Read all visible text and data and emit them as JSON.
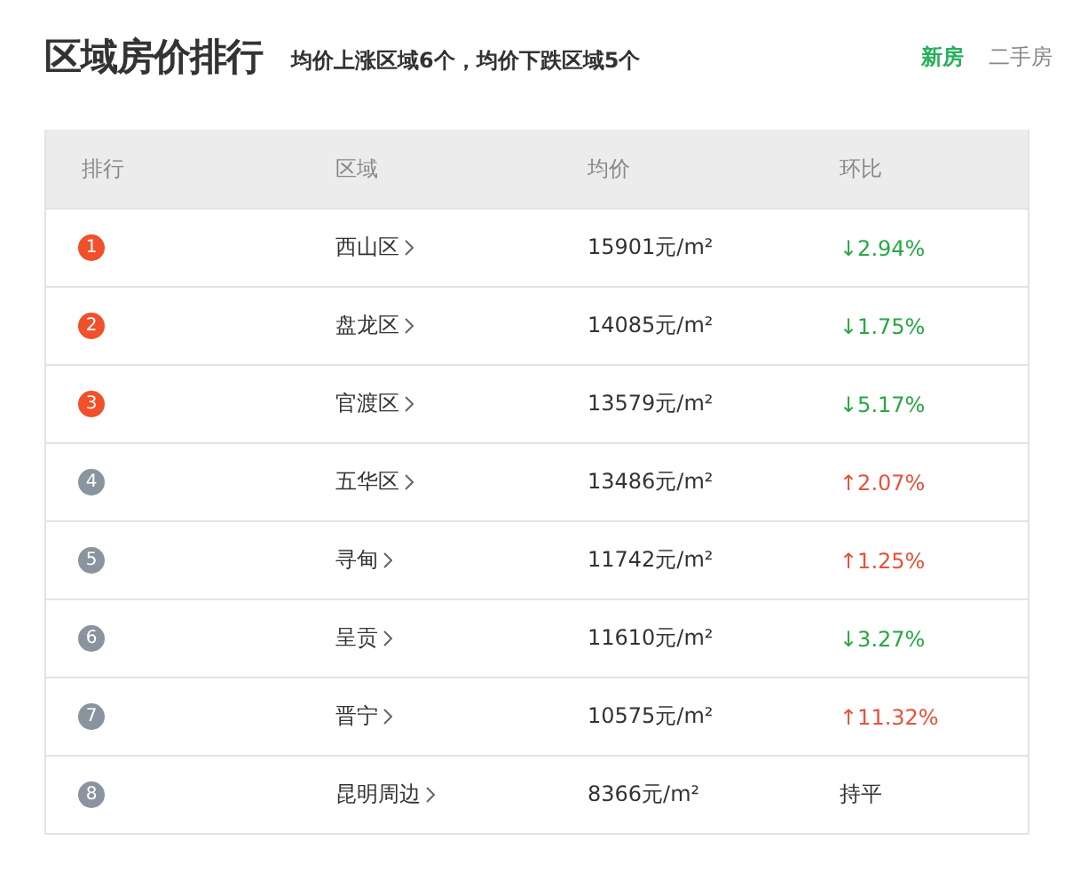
{
  "title": "区域房价排行",
  "summary": "均价上涨区域6个，均价下跌区域5个",
  "tabs": [
    {
      "label": "新房",
      "selected": true
    },
    {
      "label": "二手房",
      "selected": false
    }
  ],
  "table": {
    "columns": [
      "排行",
      "区域",
      "均价",
      "环比"
    ],
    "rows": [
      {
        "rank": "1",
        "color": "#f0502a",
        "district": "西山区",
        "price": "15901元/m²",
        "change": "↓2.94%",
        "kind": "down"
      },
      {
        "rank": "2",
        "color": "#f0502a",
        "district": "盘龙区",
        "price": "14085元/m²",
        "change": "↓1.75%",
        "kind": "down"
      },
      {
        "rank": "3",
        "color": "#f0502a",
        "district": "官渡区",
        "price": "13579元/m²",
        "change": "↓5.17%",
        "kind": "down"
      },
      {
        "rank": "4",
        "color": "#8a949e",
        "district": "五华区",
        "price": "13486元/m²",
        "change": "↑2.07%",
        "kind": "up"
      },
      {
        "rank": "5",
        "color": "#8a949e",
        "district": "寻甸",
        "price": "11742元/m²",
        "change": "↑1.25%",
        "kind": "up"
      },
      {
        "rank": "6",
        "color": "#8a949e",
        "district": "呈贡",
        "price": "11610元/m²",
        "change": "↓3.27%",
        "kind": "down"
      },
      {
        "rank": "7",
        "color": "#8a949e",
        "district": "晋宁",
        "price": "10575元/m²",
        "change": "↑11.32%",
        "kind": "up"
      },
      {
        "rank": "8",
        "color": "#8a949e",
        "district": "昆明周边",
        "price": "8366元/m²",
        "change": "持平",
        "kind": "flat"
      }
    ]
  }
}
